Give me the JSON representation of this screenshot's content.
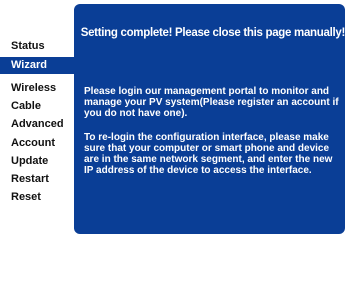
{
  "sidebar": {
    "items": [
      {
        "label": "Status"
      },
      {
        "label": "Wizard"
      },
      {
        "label": "Wireless"
      },
      {
        "label": "Cable"
      },
      {
        "label": "Advanced"
      },
      {
        "label": "Account"
      },
      {
        "label": "Update"
      },
      {
        "label": "Restart"
      },
      {
        "label": "Reset"
      }
    ],
    "active": "Wizard"
  },
  "panel": {
    "title": "Setting complete! Please close this page manually!",
    "paragraph1": "Please login our management portal to monitor and manage your PV system(Please register an account if you do not have one).",
    "paragraph2": "To re-login the configuration interface, please make sure that your computer or smart phone and device are in the same network segment, and enter the new IP address of the device to access the interface."
  },
  "colors": {
    "accent": "#0a3e96",
    "text_on_accent": "#ffffff",
    "nav_text": "#111111"
  }
}
